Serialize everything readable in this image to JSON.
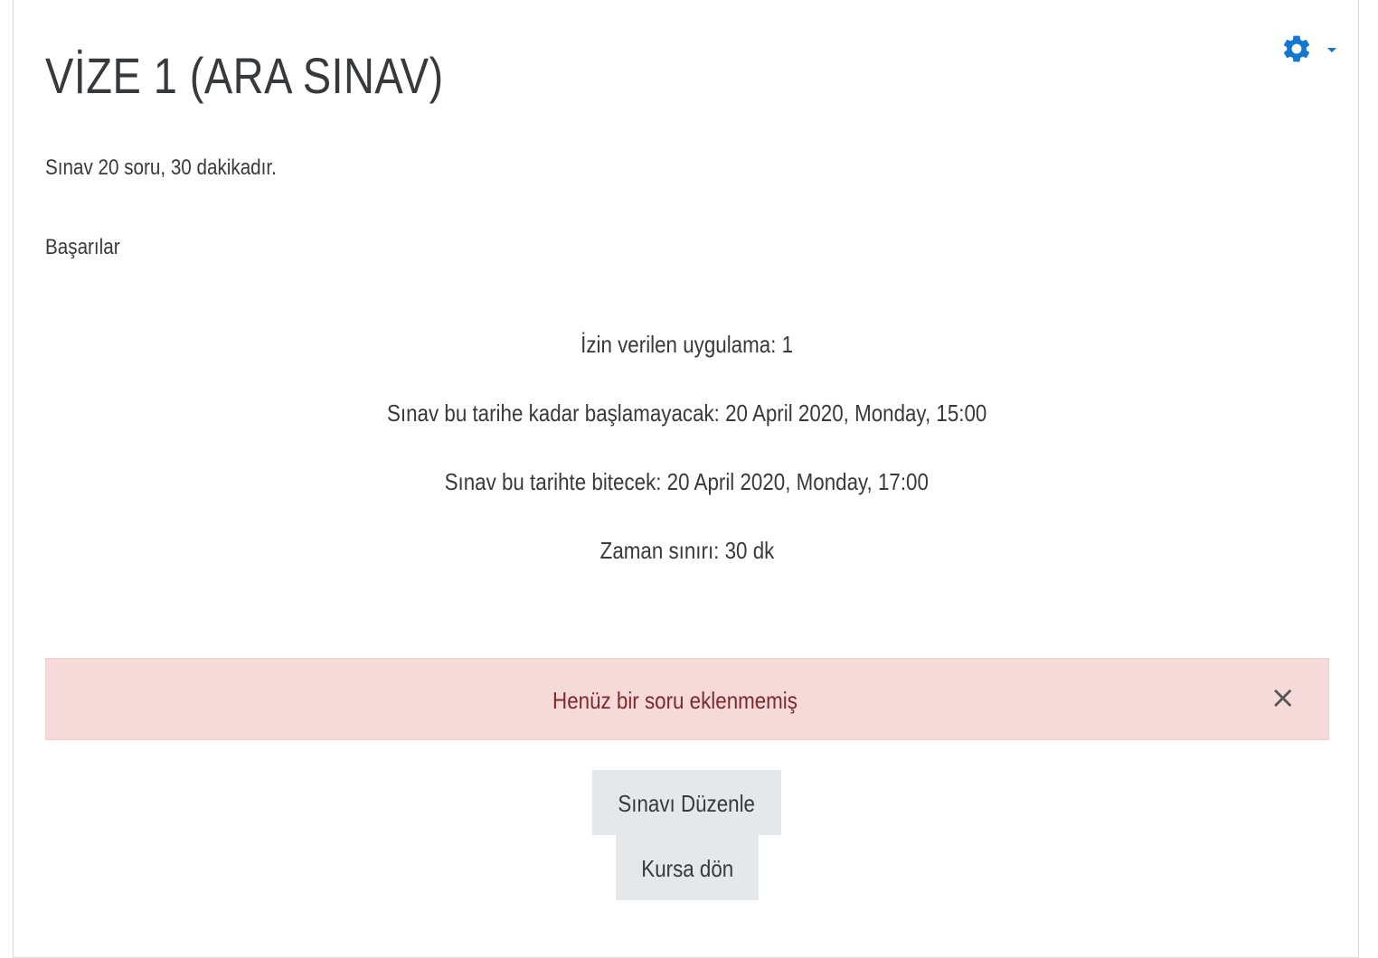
{
  "page": {
    "title": "VİZE 1 (ARA SINAV)"
  },
  "settings_menu": {
    "icon": "gear-icon",
    "caret_icon": "caret-down-icon",
    "accent_color": "#1177d1"
  },
  "intro": {
    "line1": "Sınav 20 soru, 30 dakikadır.",
    "line2": "Başarılar"
  },
  "quiz_info": {
    "attempts": "İzin verilen uygulama: 1",
    "opens": "Sınav bu tarihe kadar başlamayacak: 20 April 2020, Monday, 15:00",
    "closes": "Sınav bu tarihte bitecek: 20 April 2020, Monday, 17:00",
    "time_limit": "Zaman sınırı: 30 dk"
  },
  "alert": {
    "message": "Henüz bir soru eklenmemiş",
    "close_symbol": "×",
    "background_color": "#f6dada"
  },
  "buttons": {
    "edit_quiz": "Sınavı Düzenle",
    "back_to_course": "Kursa dön"
  }
}
